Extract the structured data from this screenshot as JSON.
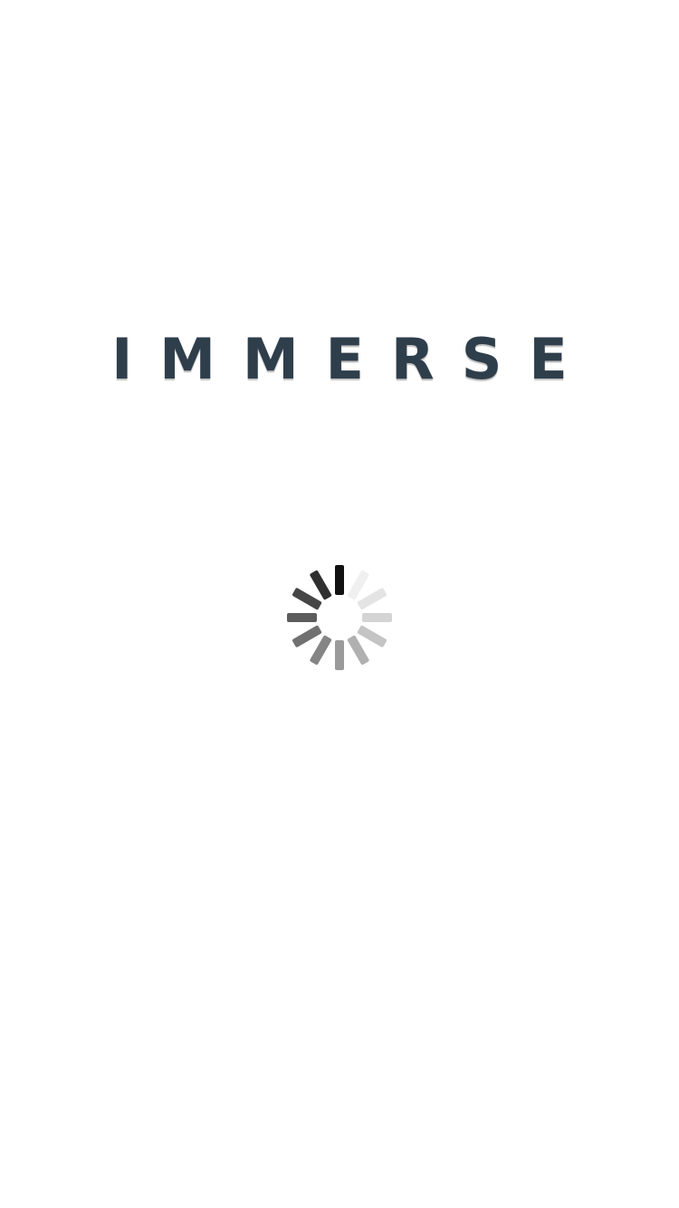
{
  "app": {
    "brand_title": "IMMERSE"
  },
  "loading": {
    "spinner_icon": "activity-indicator-icon",
    "spinner_segments": 12,
    "spinner_colors": [
      "#111111",
      "#f0f0f0",
      "#e4e4e4",
      "#d4d4d4",
      "#c4c4c4",
      "#b0b0b0",
      "#9a9a9a",
      "#858585",
      "#707070",
      "#5c5c5c",
      "#464646",
      "#2f2f2f"
    ]
  }
}
